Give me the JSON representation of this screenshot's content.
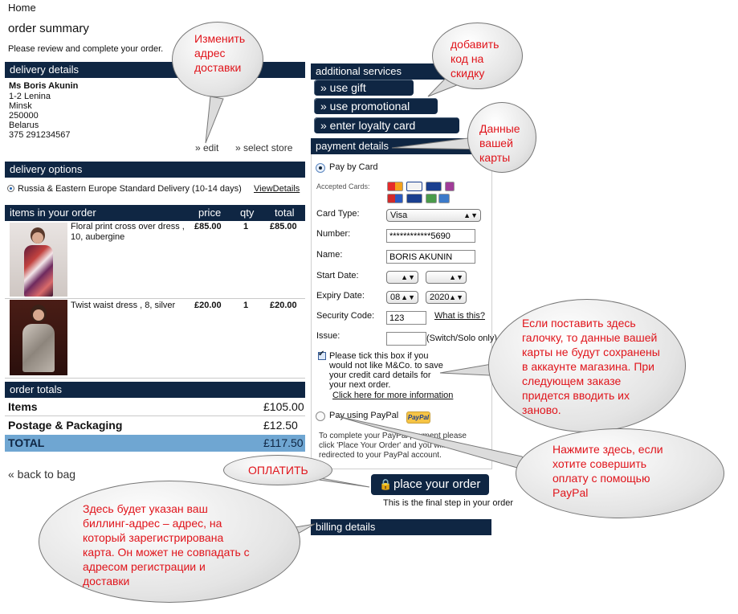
{
  "breadcrumb": "Home",
  "page_title": "order summary",
  "intro": "Please review and complete your order.",
  "delivery_details": {
    "header": "delivery details",
    "name": "Ms Boris Akunin",
    "address": [
      "1-2 Lenina",
      "Minsk",
      "250000",
      "Belarus",
      "375 291234567"
    ],
    "edit_label": "» edit",
    "select_store_label": "» select store"
  },
  "delivery_options": {
    "header": "delivery options",
    "option": "Russia & Eastern Europe Standard Delivery (10-14 days)",
    "view_details": "ViewDetails"
  },
  "items": {
    "header": "items in your order",
    "col_price": "price",
    "col_qty": "qty",
    "col_total": "total",
    "rows": [
      {
        "description": "Floral print cross over dress , 10, aubergine",
        "price": "£85.00",
        "qty": "1",
        "total": "£85.00"
      },
      {
        "description": "Twist waist dress , 8, silver",
        "price": "£20.00",
        "qty": "1",
        "total": "£20.00"
      }
    ]
  },
  "order_totals": {
    "header": "order totals",
    "items_label": "Items",
    "items_value": "£105.00",
    "postage_label": "Postage & Packaging",
    "postage_value": "£12.50",
    "total_label": "TOTAL",
    "total_value": "£117.50"
  },
  "back_to_bag": "« back to bag",
  "additional_services": {
    "header": "additional services",
    "gift": "» use gift certificate",
    "promo": "» use promotional code",
    "loyalty": "» enter loyalty card number"
  },
  "payment": {
    "header": "payment details",
    "pay_by_card": "Pay by Card",
    "accepted_cards": "Accepted Cards:",
    "card_type_label": "Card Type:",
    "card_type_value": "Visa",
    "number_label": "Number:",
    "number_value": "************5690",
    "name_label": "Name:",
    "name_value": "BORIS AKUNIN",
    "start_label": "Start Date:",
    "expiry_label": "Expiry Date:",
    "expiry_month": "08",
    "expiry_year": "2020",
    "security_label": "Security Code:",
    "security_value": "123",
    "what_is_this": "What is this?",
    "issue_label": "Issue:",
    "issue_note": "(Switch/Solo only)",
    "tick_text": [
      "Please tick this box if you",
      "would not like M&Co. to save",
      "your credit card details for",
      "your next order."
    ],
    "more_info": "Click here for more information",
    "pay_paypal": "Pay using PayPal",
    "paypal_badge": "PayPal",
    "paypal_note": [
      "To complete your PayPal payment please",
      "click 'Place Your Order' and you will be",
      "redirected to your PayPal account."
    ]
  },
  "place_order": {
    "label": "place your order",
    "note": "This is the final step in your order"
  },
  "billing": {
    "header": "billing details"
  },
  "callouts": {
    "change_address": [
      "Изменить",
      "адрес",
      "доставки"
    ],
    "discount": [
      "добавить",
      "код на",
      "скидку"
    ],
    "card_data": [
      "Данные",
      "вашей",
      "карты"
    ],
    "tick_info": [
      "Если поставить здесь",
      "галочку, то данные вашей",
      "карты не будут сохранены",
      "в аккаунте магазина. При",
      "следующем заказе",
      "придется вводить их",
      "заново."
    ],
    "paypal_info": [
      "Нажмите здесь, если",
      "хотите совершить",
      "оплату с помощью",
      "PayPal"
    ],
    "pay": "ОПЛАТИТЬ",
    "billing_info": [
      "Здесь будет указан ваш",
      "биллинг-адрес – адрес, на",
      "который зарегистрирована",
      "карта. Он может не совпадать с",
      "адресом регистрации и",
      "доставки"
    ]
  },
  "colors": {
    "header_bg": "#0f2643",
    "total_bg": "#6fa6d2",
    "callout_text": "#e0141b"
  }
}
